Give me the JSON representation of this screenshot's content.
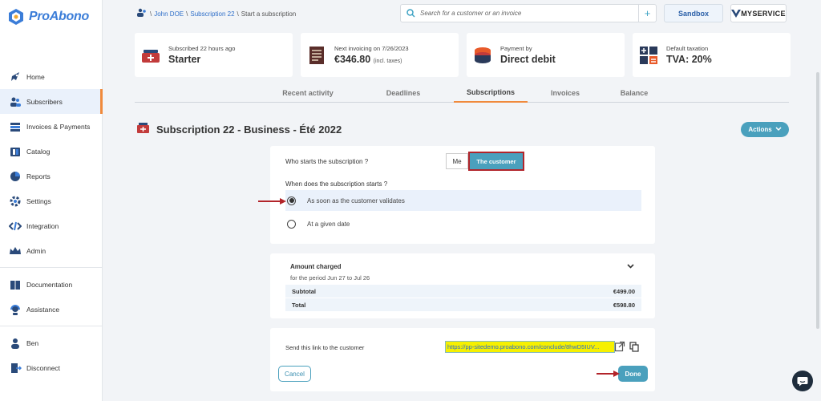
{
  "brand": {
    "name": "ProAbono"
  },
  "nav": {
    "items": [
      {
        "label": "Home",
        "icon": "rocket-icon"
      },
      {
        "label": "Subscribers",
        "icon": "users-icon",
        "active": true
      },
      {
        "label": "Invoices & Payments",
        "icon": "invoices-icon"
      },
      {
        "label": "Catalog",
        "icon": "catalog-icon"
      },
      {
        "label": "Reports",
        "icon": "pie-chart-icon"
      },
      {
        "label": "Settings",
        "icon": "gear-icon"
      },
      {
        "label": "Integration",
        "icon": "code-icon"
      },
      {
        "label": "Admin",
        "icon": "crown-icon"
      }
    ],
    "help": [
      {
        "label": "Documentation",
        "icon": "book-icon"
      },
      {
        "label": "Assistance",
        "icon": "headset-icon"
      }
    ],
    "account": [
      {
        "label": "Ben",
        "icon": "user-icon"
      },
      {
        "label": "Disconnect",
        "icon": "door-icon"
      }
    ]
  },
  "breadcrumb": {
    "sep": "\\",
    "item1": "John DOE",
    "item2": "Subscription 22",
    "item3": "Start a subscription"
  },
  "search": {
    "placeholder": "Search for a customer or an invoice",
    "plus": "+"
  },
  "sandbox": "Sandbox",
  "myservice": "MYSERVICE",
  "cards": [
    {
      "label": "Subscribed 22 hours ago",
      "value": "Starter",
      "extra": ""
    },
    {
      "label": "Next invoicing on 7/26/2023",
      "value": "€346.80",
      "extra": "(incl. taxes)"
    },
    {
      "label": "Payment by",
      "value": "Direct debit",
      "extra": ""
    },
    {
      "label": "Default taxation",
      "value": "TVA: 20%",
      "extra": ""
    }
  ],
  "tabs": [
    "Recent activity",
    "Deadlines",
    "Subscriptions",
    "Invoices",
    "Balance"
  ],
  "subscription": {
    "title": "Subscription 22 - Business - Été 2022",
    "actions": "Actions"
  },
  "starter": {
    "question1": "Who starts the subscription ?",
    "me": "Me",
    "customer": "The customer",
    "question2": "When does the subscription starts ?",
    "option1": "As soon as the customer validates",
    "option2": "At a given date"
  },
  "amount": {
    "title": "Amount charged",
    "period": "for the period Jun 27 to Jul 26",
    "subtotal_label": "Subtotal",
    "subtotal_value": "€499.00",
    "total_label": "Total",
    "total_value": "€598.80"
  },
  "send": {
    "label": "Send this link to the customer",
    "link": "https://pp-sitedemo.proabono.com/conclude/8hwD5IUV...",
    "cancel": "Cancel",
    "done": "Done"
  },
  "colors": {
    "accent": "#4aa0bd",
    "highlight": "#b2242a",
    "brand": "#3b7dd8",
    "active_tab": "#f08a3c"
  }
}
